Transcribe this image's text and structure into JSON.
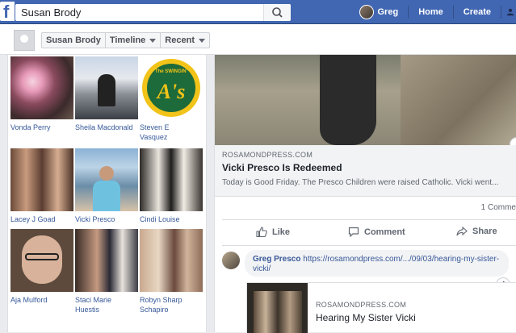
{
  "topbar": {
    "logo": "f",
    "search_value": "Susan Brody",
    "user_name": "Greg",
    "nav": [
      "Home",
      "Create"
    ]
  },
  "subheader": {
    "crumbs": [
      "Susan Brody",
      "Timeline",
      "Recent"
    ]
  },
  "friends": [
    {
      "name": "Vonda Perry"
    },
    {
      "name": "Sheila Macdonald"
    },
    {
      "name": "Steven E Vasquez"
    },
    {
      "name": "Lacey J Goad"
    },
    {
      "name": "Vicki Presco"
    },
    {
      "name": "Cindi Louise"
    },
    {
      "name": "Aja Mulford"
    },
    {
      "name": "Staci Marie Huestis"
    },
    {
      "name": "Robyn Sharp Schapiro"
    }
  ],
  "post": {
    "domain": "ROSAMONDPRESS.COM",
    "title": "Vicki Presco Is Redeemed",
    "snippet": "Today is Good Friday. The Presco Children were raised Catholic. Vicki went...",
    "comments_count": "1 Comme",
    "actions": [
      "Like",
      "Comment",
      "Share"
    ],
    "info_glyph": "i"
  },
  "comment": {
    "author": "Greg Presco",
    "link": "https://rosamondpress.com/.../09/03/hearing-my-sister-vicki/",
    "card_domain": "ROSAMONDPRESS.COM",
    "card_title": "Hearing My Sister Vicki"
  },
  "logo_text": {
    "swingin": "The SWINGIN'",
    "as": "A's"
  },
  "colors": {
    "brand": "#4267b2",
    "link": "#365899",
    "muted": "#606770"
  }
}
